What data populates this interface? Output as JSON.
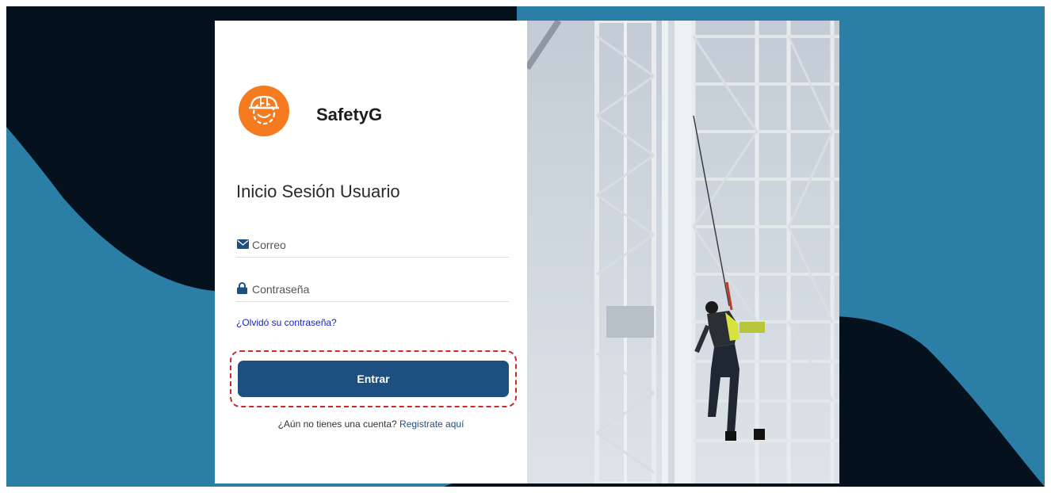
{
  "colors": {
    "background_light": "#ffffff",
    "background_dark": "#05111d",
    "background_blue": "#2b7fa6",
    "brand_orange": "#f47b20",
    "primary_button": "#1d4f80",
    "link_blue": "#1a22c8",
    "highlight_dashed": "#cc2a2a"
  },
  "brand": {
    "name": "SafetyG",
    "logo_icon": "hardhat-gear-icon"
  },
  "login": {
    "heading": "Inicio Sesión Usuario",
    "email": {
      "placeholder": "Correo",
      "value": "",
      "icon": "envelope-icon"
    },
    "password": {
      "placeholder": "Contraseña",
      "value": "",
      "icon": "lock-icon"
    },
    "forgot_link": "¿Olvidó su contraseña?",
    "submit_label": "Entrar",
    "signup_prompt": "¿Aún no tienes una cuenta?",
    "signup_link": "Registrate aquí"
  },
  "hero_image": {
    "subject": "worker-climbing-scaffold-icon"
  }
}
